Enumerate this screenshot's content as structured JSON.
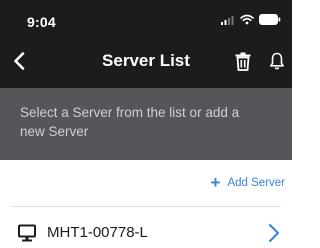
{
  "status_bar": {
    "time": "9:04",
    "icons": [
      "signal-icon",
      "wifi-icon",
      "battery-icon"
    ]
  },
  "nav": {
    "title": "Server List",
    "back_icon": "chevron-left-icon",
    "actions": [
      "trash-icon",
      "bell-icon"
    ]
  },
  "info": {
    "message": "Select a Server from the list or add a new Server"
  },
  "add_server": {
    "icon": "plus-icon",
    "label": "Add Server"
  },
  "servers": [
    {
      "icon": "monitor-icon",
      "name": "MHT1-00778-L",
      "action_icon": "chevron-right-icon"
    }
  ],
  "colors": {
    "header_bg": "#1c1c1e",
    "info_bg": "#55555a",
    "accent": "#3b82d6",
    "text_dark": "#1c1c1e"
  }
}
